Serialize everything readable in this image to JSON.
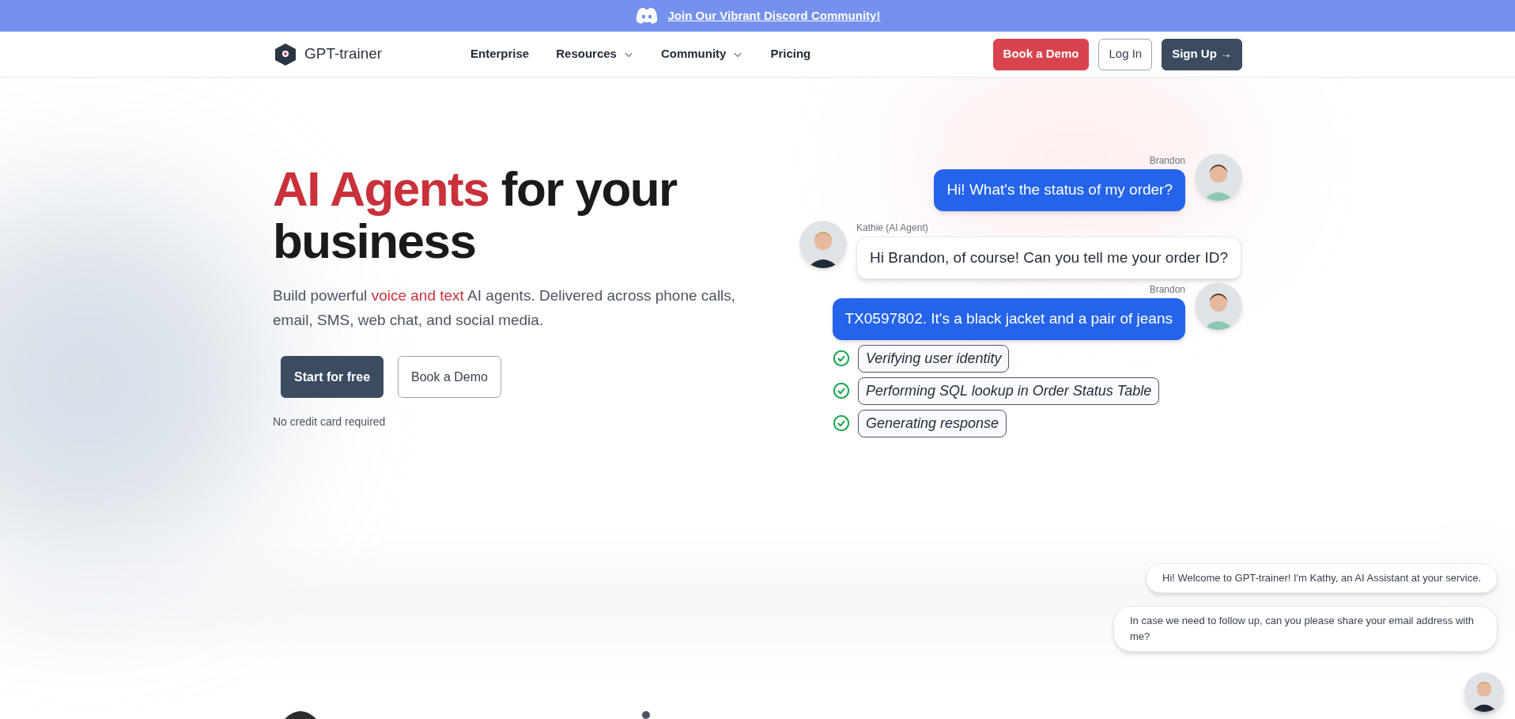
{
  "banner": {
    "text": "Join Our Vibrant Discord Community!"
  },
  "nav": {
    "brand": "GPT-trainer",
    "links": [
      {
        "label": "Enterprise",
        "dropdown": false
      },
      {
        "label": "Resources",
        "dropdown": true
      },
      {
        "label": "Community",
        "dropdown": true
      },
      {
        "label": "Pricing",
        "dropdown": false
      }
    ],
    "buttons": [
      {
        "label": "Book a Demo",
        "kind": "danger"
      },
      {
        "label": "Log In",
        "kind": "outline"
      },
      {
        "label": "Sign Up →",
        "kind": "dark"
      }
    ]
  },
  "hero": {
    "title_highlight": "AI Agents",
    "title_rest": "for your business",
    "subtitle": {
      "before": "Build powerful",
      "highlight": "voice and text",
      "after": "AI agents. Delivered across phone calls, email, SMS, web chat, and social media."
    },
    "buttons": [
      {
        "label": "Start for free",
        "kind": "dark"
      },
      {
        "label": "Book a Demo",
        "kind": "outline"
      }
    ],
    "note": "No credit card required"
  },
  "chat": {
    "messages": [
      {
        "sender": "Brandon",
        "kind": "user",
        "text": "Hi! What's the status of my order?"
      },
      {
        "sender": "Kathie (AI Agent)",
        "kind": "agent",
        "text": "Hi Brandon, of course! Can you tell me your order ID?"
      },
      {
        "sender": "Brandon",
        "kind": "user",
        "text": "TX0597802. It's a black jacket and a pair of jeans"
      }
    ],
    "steps": [
      {
        "text": "Verifying user identity",
        "done": true
      },
      {
        "text": "Performing SQL lookup in Order Status Table",
        "done": true
      },
      {
        "text": "Generating response",
        "done": true
      }
    ]
  },
  "widget": {
    "messages": [
      "Hi! Welcome to GPT-trainer! I'm Kathy, an AI Assistant at your service.",
      "In case we need to follow up, can you please share your email address with me?"
    ]
  }
}
